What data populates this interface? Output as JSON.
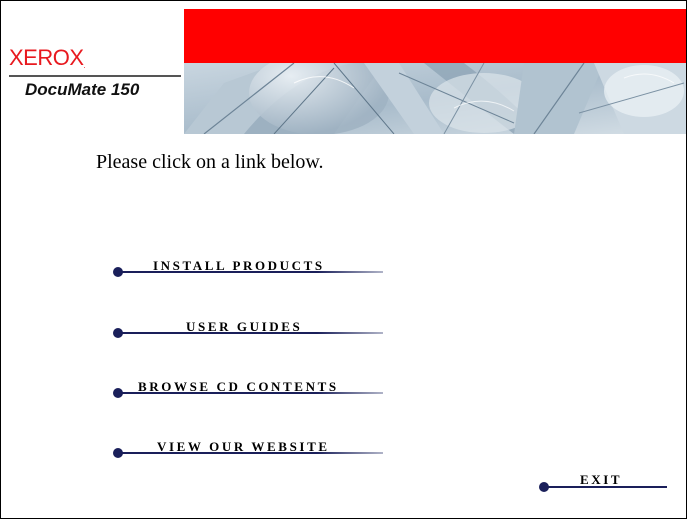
{
  "brand": {
    "logo": "XEROX",
    "logo_mark": ".",
    "model": "DocuMate 150"
  },
  "instruction": "Please click on a link below.",
  "menu": {
    "install_products": "INSTALL PRODUCTS",
    "user_guides": "USER GUIDES",
    "browse_cd_contents": "BROWSE CD CONTENTS",
    "view_our_website": "VIEW OUR WEBSITE",
    "exit": "EXIT"
  },
  "colors": {
    "brand_red": "#e8191f",
    "banner_red": "#ff0000",
    "link_accent": "#1a1f5a"
  }
}
